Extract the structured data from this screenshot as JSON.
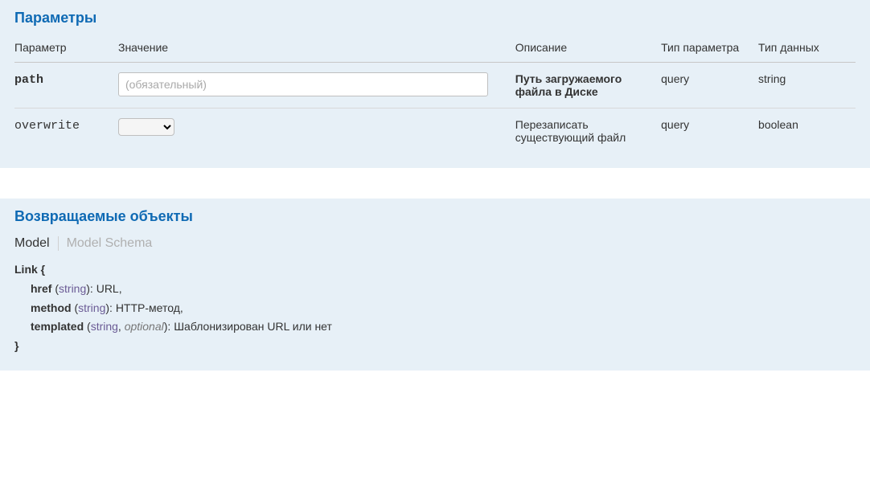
{
  "parameters": {
    "title": "Параметры",
    "headers": {
      "param": "Параметр",
      "value": "Значение",
      "desc": "Описание",
      "ptype": "Тип параметра",
      "dtype": "Тип данных"
    },
    "rows": [
      {
        "name": "path",
        "bold": true,
        "input_placeholder": "(обязательный)",
        "input_type": "text",
        "desc": "Путь загружаемого файла в Диске",
        "desc_bold": true,
        "ptype": "query",
        "dtype": "string"
      },
      {
        "name": "overwrite",
        "bold": false,
        "input_type": "select",
        "desc": "Перезаписать существующий файл",
        "desc_bold": false,
        "ptype": "query",
        "dtype": "boolean"
      }
    ]
  },
  "responses": {
    "title": "Возвращаемые объекты",
    "tabs": {
      "model": "Model",
      "schema": "Model Schema"
    },
    "model": {
      "name": "Link",
      "props": [
        {
          "name": "href",
          "type": "string",
          "optional": false,
          "desc": "URL"
        },
        {
          "name": "method",
          "type": "string",
          "optional": false,
          "desc": "HTTP-метод"
        },
        {
          "name": "templated",
          "type": "string",
          "optional": true,
          "desc": "Шаблонизирован URL или нет"
        }
      ],
      "optional_label": "optional"
    }
  }
}
